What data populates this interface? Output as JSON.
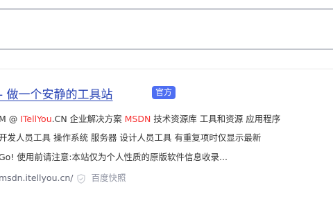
{
  "search": {
    "value": ""
  },
  "result": {
    "title": "- 做一个安静的工具站",
    "badge": "官方",
    "snippet_line1": {
      "prefix": "M @ ",
      "hl1": "ITellYou",
      "mid1": ".CN 企业解决方案 ",
      "hl2": "MSDN",
      "rest": " 技术资源库 工具和资源 应用程序"
    },
    "snippet_line2": "开发人员工具 操作系统 服务器 设计人员工具 有重复项时仅显示最新",
    "snippet_line3": "Go! 使用前请注意:本站仅为个人性质的原版软件信息收录...",
    "source_url": "msdn.itellyou.cn/",
    "snapshot_label": "百度快照",
    "colors": {
      "title": "#2440b3",
      "badge_bg": "#4e6ef2",
      "highlight": "#f73131",
      "url": "#626675",
      "snapshot": "#9195a3"
    },
    "icons": {
      "verified": "shield-icon"
    }
  }
}
